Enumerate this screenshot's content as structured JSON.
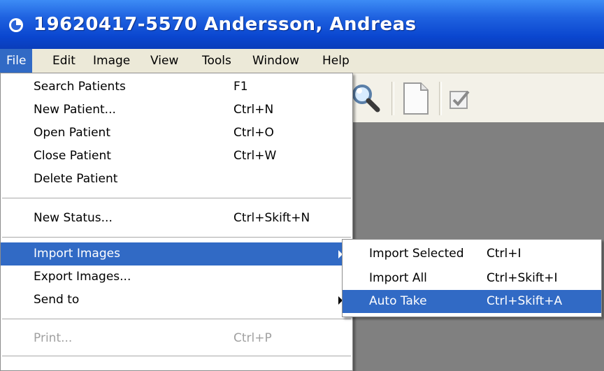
{
  "window": {
    "title": "19620417-5570 Andersson, Andreas",
    "title_color": "#0a46cf"
  },
  "menubar": [
    {
      "label": "File",
      "active": true
    },
    {
      "label": "Edit"
    },
    {
      "label": "Image"
    },
    {
      "label": "View"
    },
    {
      "label": "Tools"
    },
    {
      "label": "Window"
    },
    {
      "label": "Help"
    }
  ],
  "toolbar": {
    "icons": [
      "magnifier-icon",
      "new-document-icon",
      "checkbox-icon"
    ]
  },
  "file_menu": {
    "items": [
      {
        "label": "Search Patients",
        "shortcut": "F1"
      },
      {
        "label": "New Patient...",
        "shortcut": "Ctrl+N"
      },
      {
        "label": "Open Patient",
        "shortcut": "Ctrl+O"
      },
      {
        "label": "Close Patient",
        "shortcut": "Ctrl+W"
      },
      {
        "label": "Delete Patient",
        "shortcut": ""
      },
      {
        "label": "New Status...",
        "shortcut": "Ctrl+Skift+N"
      },
      {
        "label": "Import Images",
        "shortcut": "",
        "submenu": true,
        "highlighted": true
      },
      {
        "label": "Export Images...",
        "shortcut": ""
      },
      {
        "label": "Send to",
        "shortcut": "",
        "submenu": true
      },
      {
        "label": "Print...",
        "shortcut": "Ctrl+P",
        "disabled": true
      }
    ]
  },
  "import_submenu": {
    "items": [
      {
        "label": "Import Selected",
        "shortcut": "Ctrl+I"
      },
      {
        "label": "Import All",
        "shortcut": "Ctrl+Skift+I"
      },
      {
        "label": "Auto Take",
        "shortcut": "Ctrl+Skift+A",
        "highlighted": true
      }
    ]
  },
  "colors": {
    "highlight": "#316ac5",
    "menubar_bg": "#ece9d8",
    "workspace_bg": "#808080"
  }
}
